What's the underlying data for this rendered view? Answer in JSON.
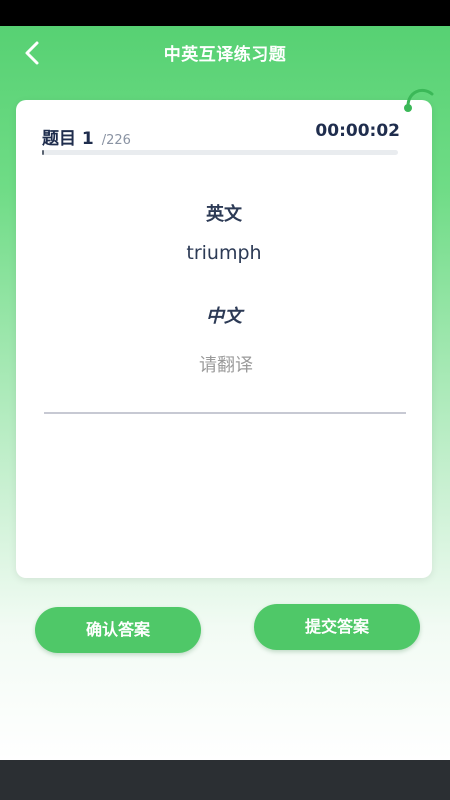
{
  "header": {
    "title": "中英互译练习题",
    "back_icon": "chevron-left-icon"
  },
  "question": {
    "label": "题目",
    "number": "1",
    "total": "/226",
    "timer": "00:00:02",
    "progress_fraction": 0.0044
  },
  "content": {
    "english_label": "英文",
    "english_word": "triumph",
    "chinese_label": "中文",
    "answer_value": "",
    "answer_placeholder": "请翻译"
  },
  "buttons": {
    "confirm_label": "确认答案",
    "submit_label": "提交答案"
  },
  "colors": {
    "accent": "#4fc868",
    "header_green": "#57d173",
    "text_dark": "#1f2d4d"
  }
}
